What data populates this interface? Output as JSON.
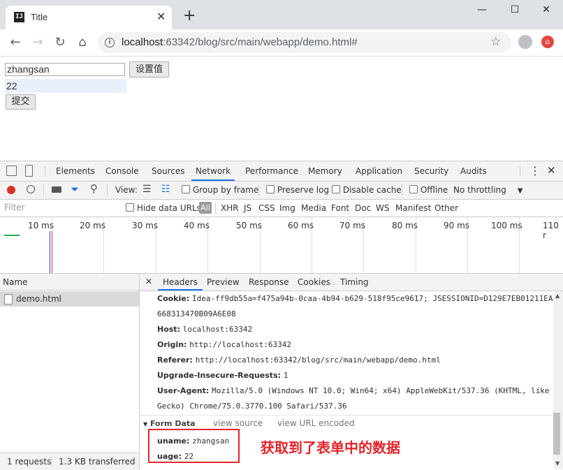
{
  "browser": {
    "tab_title": "Title",
    "tab_favicon": "IJ",
    "new_tab_label": "+",
    "url_host": "localhost",
    "url_rest": ":63342/blog/src/main/webapp/demo.html#",
    "window_minimize": "—",
    "window_maximize": "☐",
    "window_close": "✕"
  },
  "page": {
    "uname_value": "zhangsan",
    "set_button": "设置值",
    "uage_value": "22",
    "submit_button": "提交"
  },
  "devtools": {
    "tabs": [
      "Elements",
      "Console",
      "Sources",
      "Network",
      "Performance",
      "Memory",
      "Application",
      "Security",
      "Audits"
    ],
    "active_tab": "Network",
    "toolbar": {
      "view_label": "View:",
      "group_by_frame": "Group by frame",
      "preserve_log": "Preserve log",
      "disable_cache": "Disable cache",
      "offline": "Offline",
      "throttling": "No throttling"
    },
    "filter_bar": {
      "filter_placeholder": "Filter",
      "hide_data_urls": "Hide data URLs",
      "types": [
        "All",
        "XHR",
        "JS",
        "CSS",
        "Img",
        "Media",
        "Font",
        "Doc",
        "WS",
        "Manifest",
        "Other"
      ]
    },
    "timeline_ticks": [
      "10 ms",
      "20 ms",
      "30 ms",
      "40 ms",
      "50 ms",
      "60 ms",
      "70 ms",
      "80 ms",
      "90 ms",
      "100 ms",
      "110 r"
    ],
    "request_list": {
      "name_header": "Name",
      "requests": [
        "demo.html"
      ],
      "status": {
        "requests": "1 requests",
        "transferred": "1.3 KB transferred"
      }
    },
    "detail_tabs": [
      "Headers",
      "Preview",
      "Response",
      "Cookies",
      "Timing"
    ],
    "active_detail_tab": "Headers",
    "headers": [
      {
        "key": "Cookie:",
        "value": "Idea-ff9db55a=f475a94b-0caa-4b94-b629-518f95ce9617; JSESSIONID=D129E7EB01211EA"
      },
      {
        "key": "",
        "value": "668313470B09A6E08"
      },
      {
        "key": "Host:",
        "value": "localhost:63342"
      },
      {
        "key": "Origin:",
        "value": "http://localhost:63342"
      },
      {
        "key": "Referer:",
        "value": "http://localhost:63342/blog/src/main/webapp/demo.html"
      },
      {
        "key": "Upgrade-Insecure-Requests:",
        "value": "1"
      },
      {
        "key": "User-Agent:",
        "value": "Mozilla/5.0 (Windows NT 10.0; Win64; x64) AppleWebKit/537.36 (KHTML, like"
      },
      {
        "key": "",
        "value": "Gecko) Chrome/75.0.3770.100 Safari/537.36"
      }
    ],
    "form_data": {
      "title": "Form Data",
      "view_source": "view source",
      "view_url_encoded": "view URL encoded",
      "fields": [
        {
          "key": "uname:",
          "value": "zhangsan"
        },
        {
          "key": "uage:",
          "value": "22"
        }
      ]
    }
  },
  "annotation": "获取到了表单中的数据",
  "colors": {
    "annotation_red": "#e8232a",
    "active_tab_blue": "#1a73e8",
    "record_red": "#d93025"
  }
}
